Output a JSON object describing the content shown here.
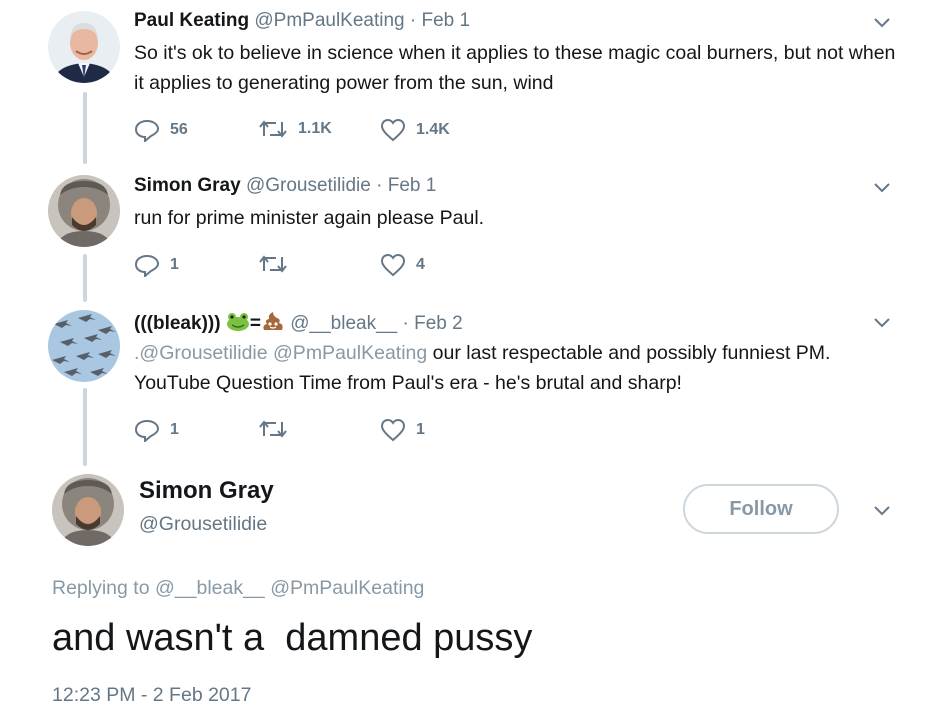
{
  "tweets": [
    {
      "name": "Paul Keating",
      "handle": "@PmPaulKeating",
      "date": "· Feb 1",
      "text": "So it's ok to believe in science when it applies to these magic coal burners, but not when it applies to generating power from the sun, wind",
      "replies": "56",
      "retweets": "1.1K",
      "likes": "1.4K"
    },
    {
      "name": "Simon Gray",
      "handle": "@Grousetilidie",
      "date": "· Feb 1",
      "text": "run for prime minister again please Paul.",
      "replies": "1",
      "retweets": "",
      "likes": "4"
    },
    {
      "name": "(((bleak)))",
      "name_suffix": "=",
      "handle": "@__bleak__",
      "date": "· Feb 2",
      "mentions": ".@Grousetilidie @PmPaulKeating",
      "text": " our last respectable and possibly funniest PM. YouTube Question Time from Paul's era - he's brutal and sharp!",
      "replies": "1",
      "retweets": "",
      "likes": "1"
    }
  ],
  "main_tweet": {
    "name": "Simon Gray",
    "handle": "@Grousetilidie",
    "follow_label": "Follow",
    "replying_label": "Replying to",
    "replying_mentions": "@__bleak__ @PmPaulKeating",
    "text": "and wasn't a  damned pussy",
    "timestamp": "12:23 PM - 2 Feb 2017"
  },
  "icons": [
    "reply-icon",
    "retweet-icon",
    "like-icon",
    "chevron-down-icon",
    "frog-emoji-icon",
    "poop-emoji-icon"
  ],
  "colors": {
    "muted": "#657786",
    "light": "#8899a6",
    "line": "#ccd6dd",
    "text": "#14171a"
  }
}
